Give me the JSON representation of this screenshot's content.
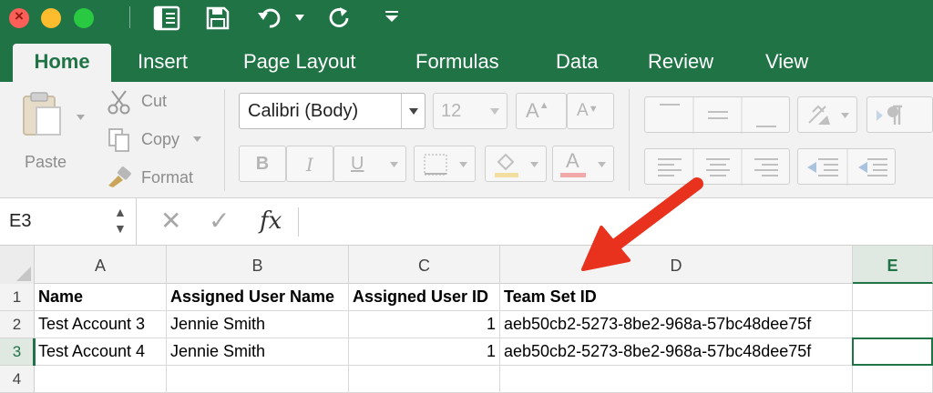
{
  "ribbon_tabs": [
    {
      "label": "Home"
    },
    {
      "label": "Insert"
    },
    {
      "label": "Page Layout"
    },
    {
      "label": "Formulas"
    },
    {
      "label": "Data"
    },
    {
      "label": "Review"
    },
    {
      "label": "View"
    }
  ],
  "clipboard": {
    "paste_label": "Paste",
    "cut_label": "Cut",
    "copy_label": "Copy",
    "format_label": "Format"
  },
  "font": {
    "family_value": "Calibri (Body)",
    "size_value": "12",
    "bold_glyph": "B",
    "italic_glyph": "I",
    "underline_glyph": "U",
    "grow_glyph": "A",
    "shrink_glyph": "A",
    "font_color_glyph": "A"
  },
  "formula_bar": {
    "name_box": "E3",
    "fx_label": "fx",
    "formula_value": ""
  },
  "columns": [
    {
      "label": "A"
    },
    {
      "label": "B"
    },
    {
      "label": "C"
    },
    {
      "label": "D"
    },
    {
      "label": "E"
    }
  ],
  "row_numbers": [
    "1",
    "2",
    "3",
    "4"
  ],
  "rows": [
    {
      "a": "Name",
      "b": "Assigned User Name",
      "c": "Assigned User ID",
      "d": "Team Set ID",
      "e": ""
    },
    {
      "a": "Test Account 3",
      "b": "Jennie Smith",
      "c": "1",
      "d": "aeb50cb2-5273-8be2-968a-57bc48dee75f",
      "e": ""
    },
    {
      "a": "Test Account 4",
      "b": "Jennie Smith",
      "c": "1",
      "d": "aeb50cb2-5273-8be2-968a-57bc48dee75f",
      "e": ""
    }
  ],
  "selected_cell": "E3",
  "colors": {
    "excel_green": "#1f7345",
    "annotation_arrow": "#e8321e"
  },
  "icons": [
    "close-icon",
    "minimize-icon",
    "zoom-icon",
    "sidebar-icon",
    "save-icon",
    "undo-icon",
    "redo-icon",
    "customize-toolbar-icon",
    "scissors-icon",
    "copy-icon",
    "format-painter-icon",
    "clipboard-icon"
  ]
}
